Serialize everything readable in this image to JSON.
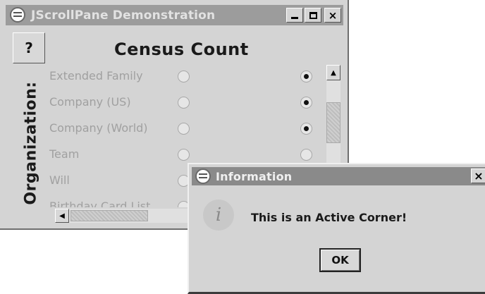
{
  "window": {
    "title": "JScrollPane Demonstration",
    "corner_button": "?",
    "minimize": "",
    "maximize": "",
    "close": "×"
  },
  "table": {
    "column_header": "Census Count",
    "row_header": "Organization:",
    "rows": [
      {
        "label": "Extended Family",
        "left_selected": false,
        "right_selected": true
      },
      {
        "label": "Company (US)",
        "left_selected": false,
        "right_selected": true
      },
      {
        "label": "Company (World)",
        "left_selected": false,
        "right_selected": true
      },
      {
        "label": "Team",
        "left_selected": false,
        "right_selected": false
      },
      {
        "label": "Will",
        "left_selected": false,
        "right_selected": false
      },
      {
        "label": "Birthday Card List",
        "left_selected": false,
        "right_selected": false
      }
    ]
  },
  "scrollbars": {
    "up_arrow": "▲",
    "left_arrow": "◀"
  },
  "dialog": {
    "title": "Information",
    "close": "×",
    "message": "This is an Active Corner!",
    "icon_glyph": "i",
    "ok_label": "OK"
  }
}
